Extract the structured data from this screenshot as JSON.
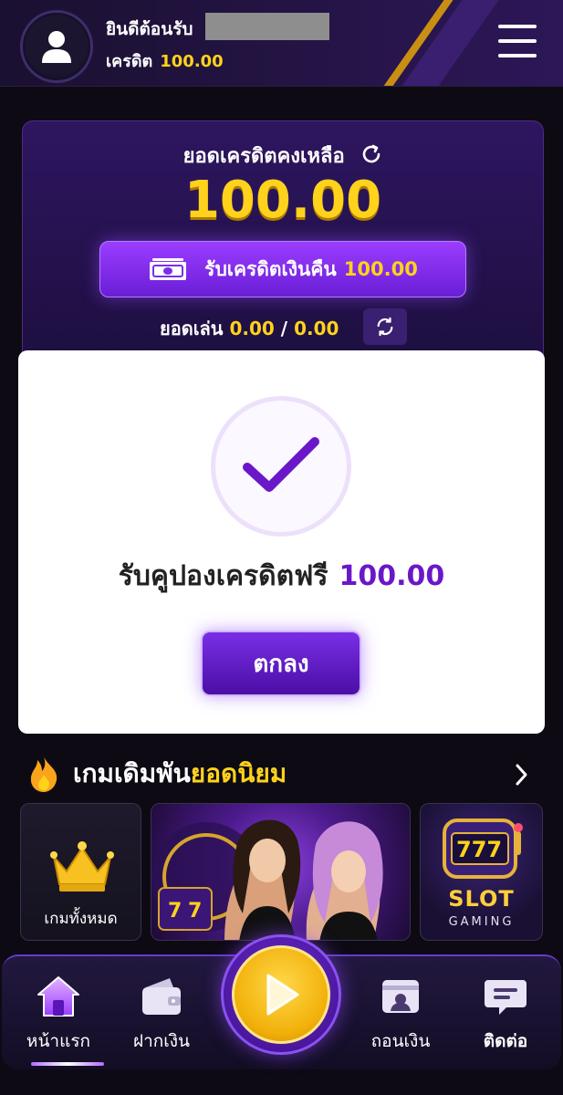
{
  "header": {
    "welcome_label": "ยินดีต้อนรับ",
    "credit_label": "เครดิต",
    "credit_value": "100.00"
  },
  "balance": {
    "title": "ยอดเครดิตคงเหลือ",
    "amount": "100.00",
    "cashback_label": "รับเครดิตเงินคืน",
    "cashback_value": "100.00",
    "play_label": "ยอดเล่น",
    "play_current": "0.00",
    "play_separator": "/",
    "play_target": "0.00"
  },
  "modal": {
    "message": "รับคูปองเครดิตฟรี",
    "amount": "100.00",
    "ok_label": "ตกลง"
  },
  "popular": {
    "title_plain": "เกมเดิมพัน",
    "title_accent": "ยอดนิยม",
    "all_games_label": "เกมทั้งหมด",
    "slot_title": "SLOT",
    "slot_subtitle": "GAMING"
  },
  "nav": {
    "home": "หน้าแรก",
    "deposit": "ฝากเงิน",
    "withdraw": "ถอนเงิน",
    "contact": "ติดต่อ"
  },
  "icons": {
    "avatar": "user-icon",
    "menu": "hamburger-menu-icon",
    "refresh": "refresh-icon",
    "cash": "cash-icon",
    "check": "check-icon",
    "fire": "fire-icon",
    "chevron": "chevron-right-icon",
    "crown": "crown-icon",
    "home": "home-icon",
    "wallet": "wallet-icon",
    "play": "play-icon",
    "withdraw": "withdraw-card-icon",
    "chat": "chat-icon"
  },
  "colors": {
    "accent_gold": "#ffd21c",
    "accent_purple": "#7a2ee6",
    "background": "#0d0a14"
  }
}
